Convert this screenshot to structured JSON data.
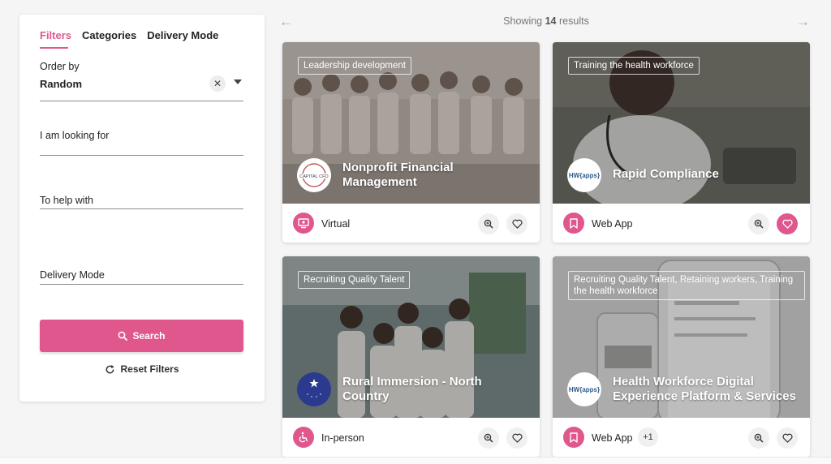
{
  "filters": {
    "tabs": [
      "Filters",
      "Categories",
      "Delivery Mode"
    ],
    "order_by_label": "Order by",
    "order_by_value": "Random",
    "looking_for_label": "I am looking for",
    "help_with_label": "To help with",
    "delivery_mode_label": "Delivery Mode",
    "search_label": "Search",
    "reset_label": "Reset Filters"
  },
  "results": {
    "prefix": "Showing",
    "count": "14",
    "suffix": "results"
  },
  "cards": [
    {
      "tag": "Leadership development",
      "title": "Nonprofit Financial Management",
      "logo_text": "CAPITAL CFO",
      "mode": "Virtual",
      "mode_icon": "virtual-icon",
      "favorited": false
    },
    {
      "tag": "Training the health workforce",
      "title": "Rapid Compliance",
      "logo_text": "HW{apps}",
      "mode": "Web App",
      "mode_icon": "bookmark-icon",
      "favorited": true
    },
    {
      "tag": "Recruiting Quality Talent",
      "title": "Rural Immersion - North Country",
      "logo_text": "",
      "mode": "In-person",
      "mode_icon": "accessibility-icon",
      "favorited": false
    },
    {
      "tag": "Recruiting Quality Talent, Retaining workers, Training the health workforce",
      "title": "Health Workforce Digital Experience Platform & Services",
      "logo_text": "HW{apps}",
      "mode": "Web App",
      "mode_icon": "bookmark-icon",
      "extra_modes": "+1",
      "favorited": false
    }
  ],
  "colors": {
    "accent": "#e0578d",
    "page_bg": "#f5f5f5"
  }
}
